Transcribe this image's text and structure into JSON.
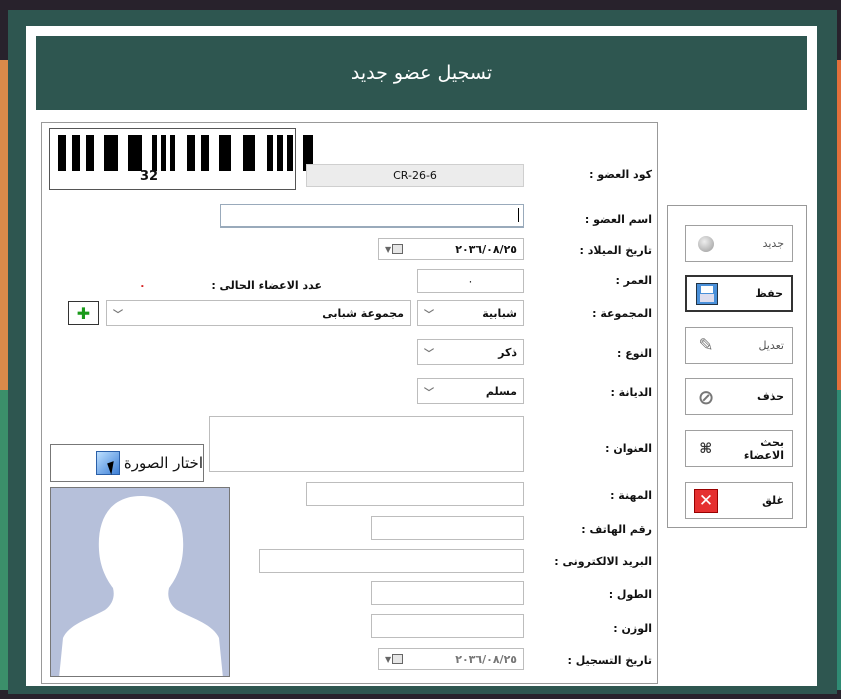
{
  "window": {
    "title": "تسجيل عضو جديد"
  },
  "barcode": {
    "number": "32"
  },
  "form": {
    "member_code": {
      "label": "كود العضو :",
      "value": "CR-26-6"
    },
    "member_name": {
      "label": "اسم العضو :",
      "value": ""
    },
    "birth_date": {
      "label": "تاريخ الميلاد :",
      "value": "٢٠٣٦/٠٨/٢٥"
    },
    "age": {
      "label": "العمر :",
      "value": "٠"
    },
    "members_count": {
      "label": "عدد الاعضاء الحالى :",
      "value": "٠"
    },
    "group": {
      "label": "المجموعة :",
      "value": "شبابية",
      "subgroup": "مجموعة شبابى"
    },
    "gender": {
      "label": "النوع :",
      "value": "ذكر"
    },
    "religion": {
      "label": "الديانة :",
      "value": "مسلم"
    },
    "address": {
      "label": "العنوان :",
      "value": ""
    },
    "job": {
      "label": "المهنة :",
      "value": ""
    },
    "phone": {
      "label": "رقم الهاتف :",
      "value": ""
    },
    "email": {
      "label": "البريد الالكترونى :",
      "value": ""
    },
    "height": {
      "label": "الطول :",
      "value": ""
    },
    "weight": {
      "label": "الوزن :",
      "value": ""
    },
    "reg_date": {
      "label": "تاريخ التسجيل :",
      "value": "٢٠٣٦/٠٨/٢٥"
    }
  },
  "photo": {
    "choose_label": "اختار الصورة"
  },
  "actions": {
    "new_label": "جديد",
    "save_label": "حفظ",
    "edit_label": "تعديل",
    "delete_label": "حذف",
    "search_label": "بحث الاعضاء",
    "close_label": "غلق"
  },
  "colors": {
    "header_bg": "#2e5650",
    "accent_red": "#d62020",
    "photo_bg": "#b6c0da"
  }
}
